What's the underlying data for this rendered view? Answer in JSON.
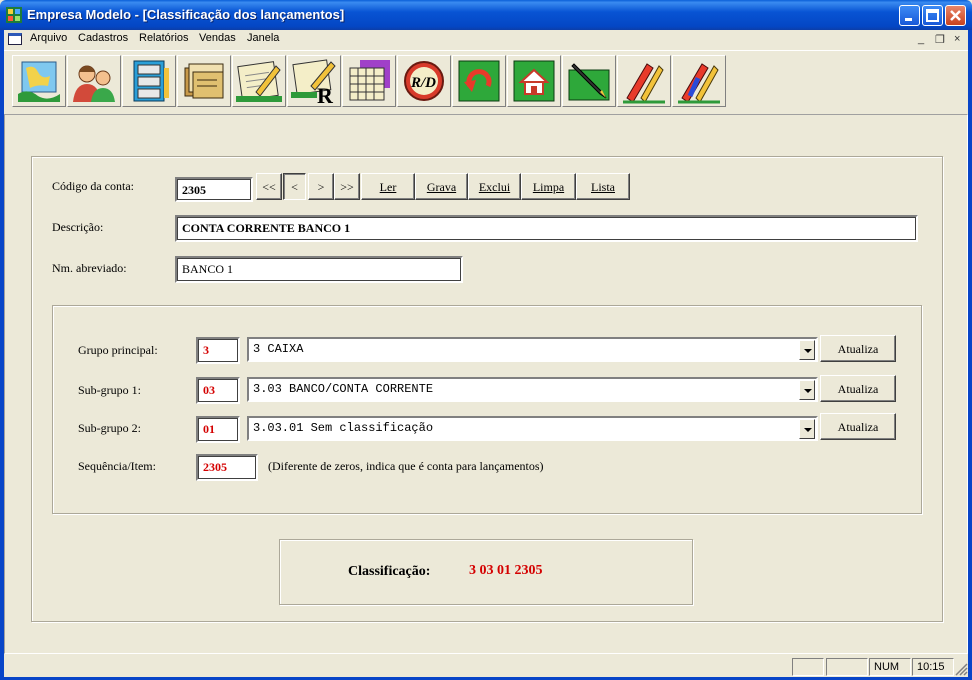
{
  "window": {
    "title": "Empresa Modelo - [Classificação dos lançamentos]",
    "colors": {
      "titlebar": "#0a54d4",
      "accent_red": "#d40000",
      "face": "#ece9d8"
    }
  },
  "menu": {
    "items": [
      "Arquivo",
      "Cadastros",
      "Relatórios",
      "Vendas",
      "Janela"
    ],
    "mdi_controls": [
      "_",
      "❐",
      "×"
    ]
  },
  "toolbar": {
    "buttons": [
      "map-icon",
      "users-icon",
      "file-cabinet-icon",
      "folders-icon",
      "notepad-pencil-icon",
      "notepad-report-icon",
      "calendar-grid-icon",
      "rd-badge-icon",
      "refresh-icon",
      "home-icon",
      "pen-icon",
      "edit-arrow-icon",
      "edit-arrow-blue-icon"
    ]
  },
  "form": {
    "codigo_label": "Código da conta:",
    "codigo_value": "2305",
    "nav": {
      "first": "<<",
      "prev": "<",
      "next": ">",
      "last": ">>"
    },
    "actions": {
      "ler": "Ler",
      "grava": "Grava",
      "exclui": "Exclui",
      "limpa": "Limpa",
      "lista": "Lista"
    },
    "descricao_label": "Descrição:",
    "descricao_value": "CONTA CORRENTE BANCO 1",
    "abreviado_label": "Nm. abreviado:",
    "abreviado_value": "BANCO 1"
  },
  "classification": {
    "grupo_label": "Grupo principal:",
    "grupo_code": "3",
    "grupo_select": "3 CAIXA",
    "sub1_label": "Sub-grupo 1:",
    "sub1_code": "03",
    "sub1_select": "3.03 BANCO/CONTA CORRENTE",
    "sub2_label": "Sub-grupo 2:",
    "sub2_code": "01",
    "sub2_select": "3.03.01 Sem classificação",
    "seq_label": "Sequência/Item:",
    "seq_code": "2305",
    "seq_hint": "(Diferente de zeros, indica que é conta para lançamentos)",
    "atualiza": "Atualiza"
  },
  "result": {
    "label": "Classificação:",
    "value": "3 03 01 2305"
  },
  "statusbar": {
    "num": "NUM",
    "time": "10:15"
  }
}
